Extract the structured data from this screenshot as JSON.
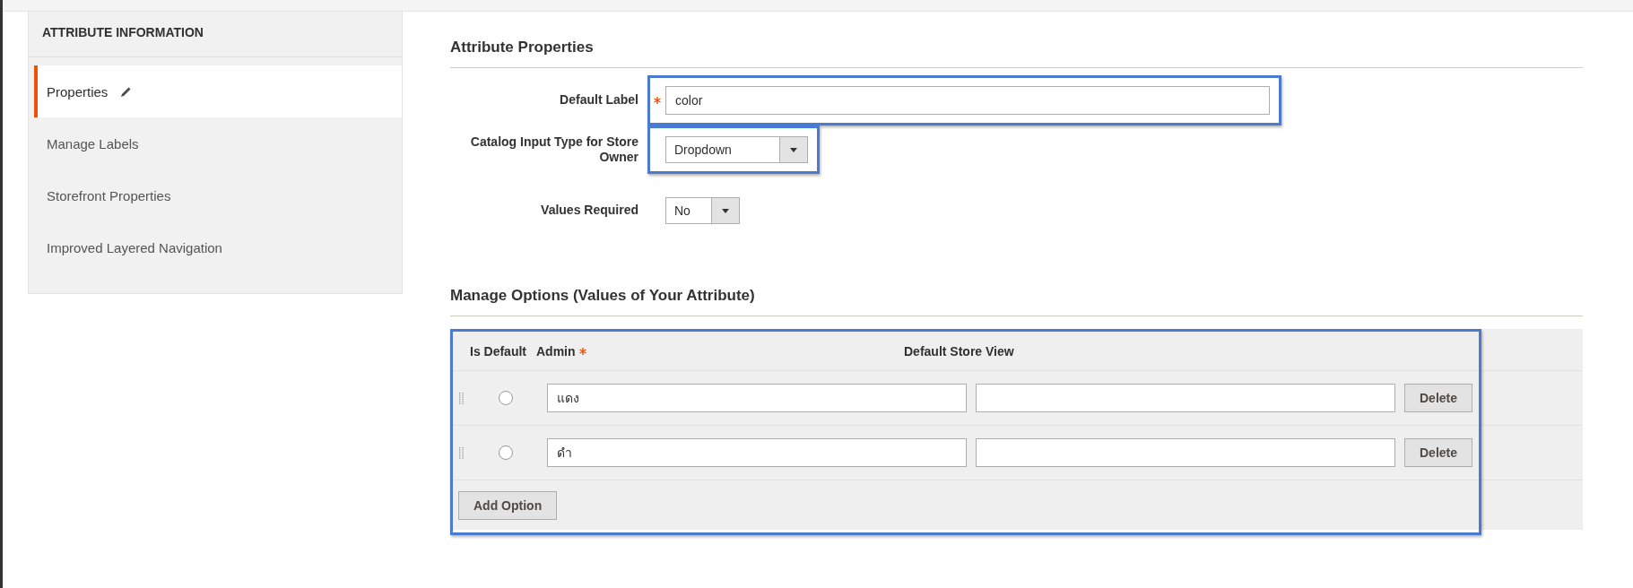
{
  "sidebar": {
    "title": "ATTRIBUTE INFORMATION",
    "items": [
      {
        "label": "Properties",
        "selected": true,
        "edited": true
      },
      {
        "label": "Manage Labels",
        "selected": false,
        "edited": false
      },
      {
        "label": "Storefront Properties",
        "selected": false,
        "edited": false
      },
      {
        "label": "Improved Layered Navigation",
        "selected": false,
        "edited": false
      }
    ]
  },
  "properties": {
    "title": "Attribute Properties",
    "fields": [
      {
        "kind": "text",
        "label": "Default Label",
        "required": true,
        "value": "color",
        "highlighted": true
      },
      {
        "kind": "select",
        "label": "Catalog Input Type for Store Owner",
        "required": false,
        "value": "Dropdown",
        "highlighted": true
      },
      {
        "kind": "select-small",
        "label": "Values Required",
        "required": false,
        "value": "No",
        "highlighted": false
      }
    ]
  },
  "options": {
    "title": "Manage Options (Values of Your Attribute)",
    "highlighted": true,
    "columns": [
      {
        "label": "Is Default",
        "required": false
      },
      {
        "label": "Admin",
        "required": true
      },
      {
        "label": "Default Store View",
        "required": false
      }
    ],
    "rows": [
      {
        "is_default": false,
        "admin": "แดง",
        "store_view": "",
        "delete": "Delete"
      },
      {
        "is_default": false,
        "admin": "ดำ",
        "store_view": "",
        "delete": "Delete"
      }
    ],
    "add_button": "Add Option"
  }
}
